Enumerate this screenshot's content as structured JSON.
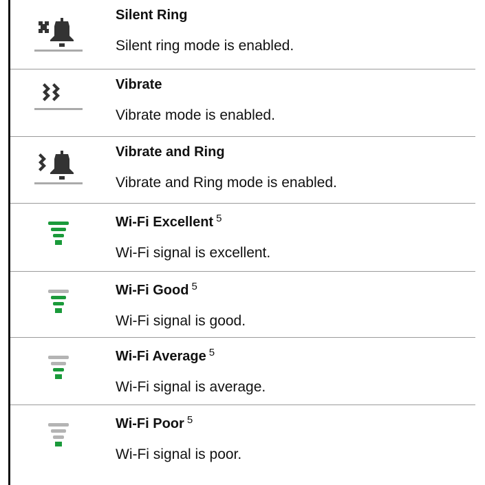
{
  "rows": [
    {
      "title": "Silent Ring",
      "description": "Silent ring mode is enabled.",
      "icon": "silent-ring-icon"
    },
    {
      "title": "Vibrate",
      "description": "Vibrate mode is enabled.",
      "icon": "vibrate-icon"
    },
    {
      "title": "Vibrate and Ring",
      "description": "Vibrate and Ring mode is enabled.",
      "icon": "vibrate-and-ring-icon"
    },
    {
      "title": "Wi-Fi Excellent",
      "footnote": "5",
      "description": "Wi-Fi signal is excellent.",
      "icon": "wifi-excellent-icon",
      "wifi_level": 4
    },
    {
      "title": "Wi-Fi Good",
      "footnote": "5",
      "description": "Wi-Fi signal is good.",
      "icon": "wifi-good-icon",
      "wifi_level": 3
    },
    {
      "title": "Wi-Fi Average",
      "footnote": "5",
      "description": "Wi-Fi signal is average.",
      "icon": "wifi-average-icon",
      "wifi_level": 2
    },
    {
      "title": "Wi-Fi Poor",
      "footnote": "5",
      "description": "Wi-Fi signal is poor.",
      "icon": "wifi-poor-icon",
      "wifi_level": 1
    }
  ],
  "colors": {
    "icon_dark": "#333333",
    "icon_gray": "#aaaaaa",
    "wifi_active": "#1a9a3a",
    "wifi_inactive": "#b4b4b4"
  }
}
